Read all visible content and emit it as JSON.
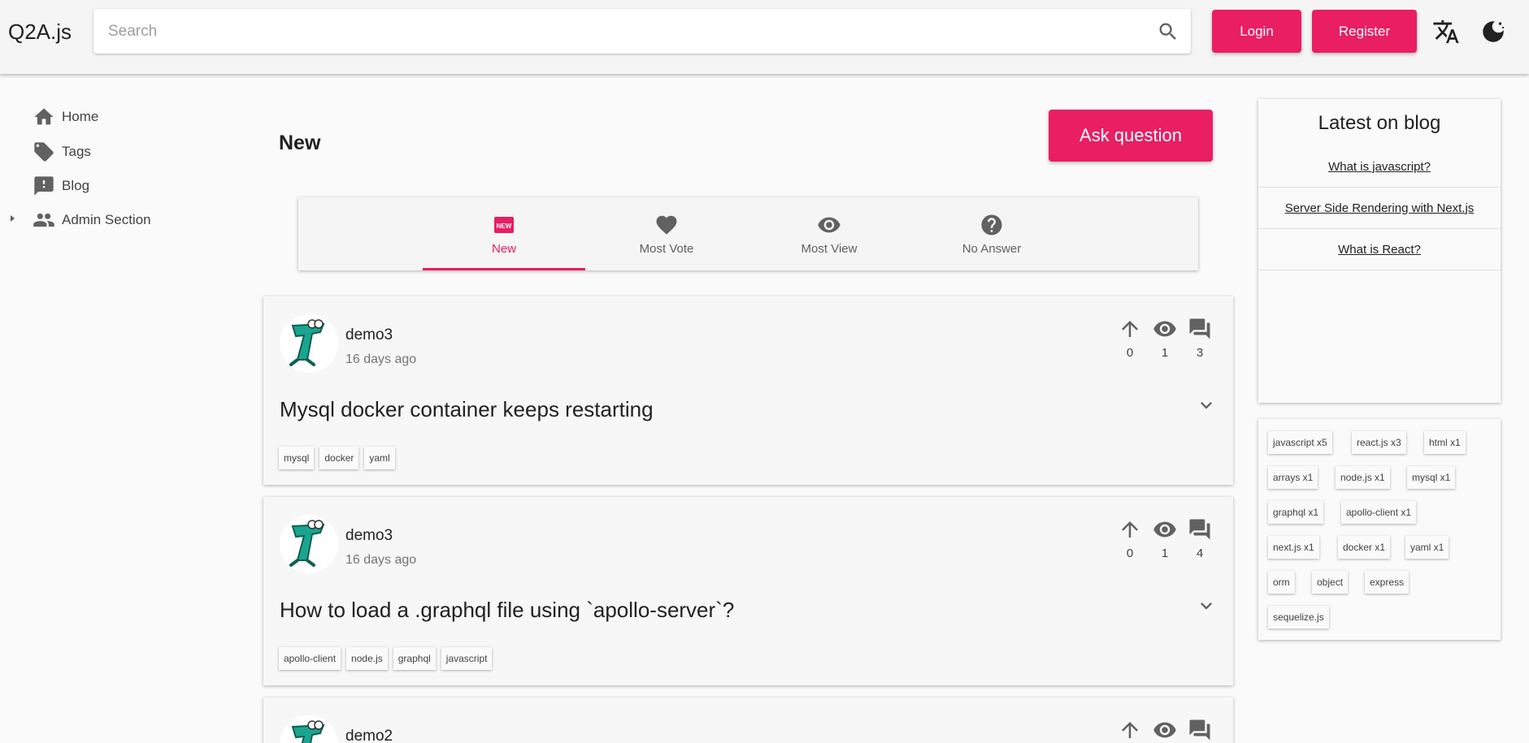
{
  "header": {
    "logo": "Q2A.js",
    "search_placeholder": "Search",
    "login_label": "Login",
    "register_label": "Register",
    "translate_icon": "translate-icon",
    "theme_icon": "dark-mode-icon"
  },
  "sidebar": {
    "items": [
      {
        "label": "Home",
        "icon": "home-icon"
      },
      {
        "label": "Tags",
        "icon": "tag-icon"
      },
      {
        "label": "Blog",
        "icon": "feedback-icon"
      },
      {
        "label": "Admin Section",
        "icon": "people-icon"
      }
    ]
  },
  "main": {
    "title": "New",
    "ask_label": "Ask question",
    "tabs": [
      {
        "label": "New",
        "icon": "new-badge-icon",
        "active": true
      },
      {
        "label": "Most Vote",
        "icon": "heart-icon"
      },
      {
        "label": "Most View",
        "icon": "eye-icon"
      },
      {
        "label": "No Answer",
        "icon": "help-icon"
      }
    ],
    "questions": [
      {
        "author": "demo3",
        "time": "16 days ago",
        "votes": "0",
        "views": "1",
        "answers": "3",
        "title": "Mysql docker container keeps restarting",
        "tags": [
          "mysql",
          "docker",
          "yaml"
        ]
      },
      {
        "author": "demo3",
        "time": "16 days ago",
        "votes": "0",
        "views": "1",
        "answers": "4",
        "title": "How to load a .graphql file using `apollo-server`?",
        "tags": [
          "apollo-client",
          "node.js",
          "graphql",
          "javascript"
        ]
      },
      {
        "author": "demo2"
      }
    ]
  },
  "right": {
    "blog_title": "Latest on blog",
    "blog_links": [
      "What is javascript?",
      "Server Side Rendering with Next.js",
      "What is React?"
    ],
    "tag_cloud": [
      "javascript x5",
      "react.js x3",
      "html x1",
      "arrays x1",
      "node.js x1",
      "mysql x1",
      "graphql x1",
      "apollo-client x1",
      "next.js x1",
      "docker x1",
      "yaml x1",
      "orm",
      "object",
      "express",
      "sequelize.js"
    ]
  },
  "colors": {
    "accent": "#e91e63",
    "avatar_green": "#1aa58f"
  }
}
